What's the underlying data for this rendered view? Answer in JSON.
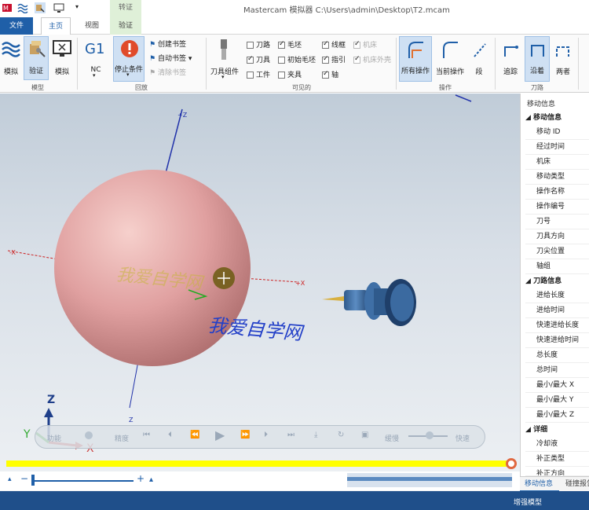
{
  "window": {
    "title": "Mastercam 模拟器  C:\\Users\\admin\\Desktop\\T2.mcam"
  },
  "ribbon_tabs": [
    "文件",
    "主页",
    "视图",
    "验证"
  ],
  "context_tab_header": "转证",
  "groups": {
    "mode": {
      "label": "模型",
      "buttons": [
        {
          "label": "模拟",
          "icon": "simulate-icon"
        },
        {
          "label": "验证",
          "icon": "verify-icon"
        },
        {
          "label": "模拟",
          "icon": "monitor-icon"
        }
      ]
    },
    "playback": {
      "label": "回放",
      "nc_label": "G1",
      "nc_sub": "NC",
      "stop_label": "停止条件",
      "small": [
        "创建书签",
        "自动书签",
        "清除书签"
      ]
    },
    "visibility": {
      "label": "可见的",
      "toolparts_label": "刀具组件",
      "checks": [
        {
          "label": "刀路",
          "on": false,
          "disabled": false
        },
        {
          "label": "毛坯",
          "on": true,
          "disabled": false
        },
        {
          "label": "线框",
          "on": true,
          "disabled": false
        },
        {
          "label": "机床",
          "on": true,
          "disabled": true
        },
        {
          "label": "刀具",
          "on": true,
          "disabled": false
        },
        {
          "label": "初始毛坯",
          "on": false,
          "disabled": false
        },
        {
          "label": "指引",
          "on": true,
          "disabled": false
        },
        {
          "label": "机床外壳",
          "on": true,
          "disabled": true
        },
        {
          "label": "工件",
          "on": false,
          "disabled": false
        },
        {
          "label": "夹具",
          "on": false,
          "disabled": false
        },
        {
          "label": "轴",
          "on": true,
          "disabled": false
        }
      ]
    },
    "operation": {
      "label": "操作",
      "buttons": [
        "所有操作",
        "当前操作",
        "段"
      ]
    },
    "toolpath": {
      "label": "刀路",
      "buttons": [
        "追踪",
        "沿着",
        "两者"
      ]
    }
  },
  "viewport": {
    "axis_labels": {
      "top": "+Z",
      "left": "-X",
      "right": "+X",
      "bottom": "Z"
    },
    "watermark": "我爱自学网",
    "triad": {
      "x": "X",
      "y": "Y",
      "z": "Z"
    },
    "sphere_color": "#e0a0a0",
    "tool_color": "#3f6fa6"
  },
  "playbar": {
    "items": [
      "精度",
      "缓慢",
      "快速"
    ],
    "speed_hint": "功能"
  },
  "right_panel": {
    "title": "移动信息",
    "sections": [
      {
        "title": "移动信息",
        "items": [
          "移动 ID",
          "经过时间",
          "机床",
          "移动类型",
          "操作名称",
          "操作编号",
          "刀号",
          "刀具方向",
          "刀尖位置",
          "轴组"
        ]
      },
      {
        "title": "刀路信息",
        "items": [
          "进给长度",
          "进给时间",
          "快速进给长度",
          "快速进给时间",
          "总长度",
          "总时间",
          "最小/最大 X",
          "最小/最大 Y",
          "最小/最大 Z"
        ]
      },
      {
        "title": "详细",
        "items": [
          "冷却液",
          "补正类型",
          "补正方向"
        ]
      }
    ],
    "tabs": [
      "移动信息",
      "碰撞报告"
    ]
  },
  "status": {
    "text": "增强模型"
  },
  "colors": {
    "accent": "#1f5fa8",
    "progress": "#ffff00",
    "status_bar": "#1f4f8a"
  }
}
